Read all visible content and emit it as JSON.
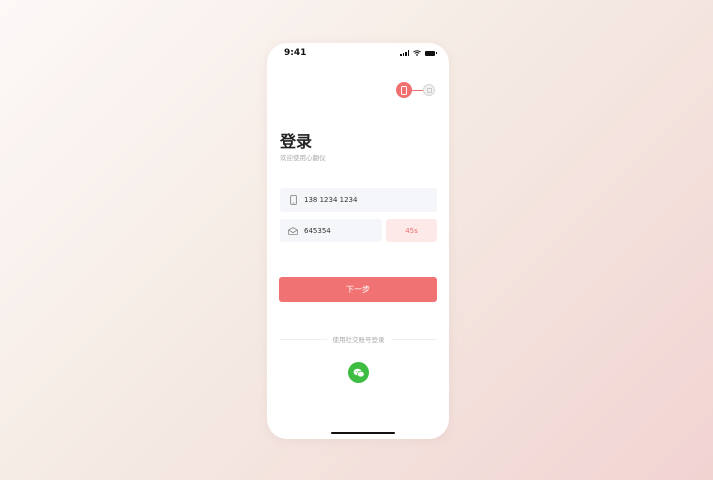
{
  "status_bar": {
    "time": "9:41"
  },
  "steps": {
    "active_icon": "phone-icon",
    "inactive_icon": "document-icon"
  },
  "login": {
    "title": "登录",
    "subtitle": "欢迎使用心翻仪"
  },
  "phone_field": {
    "value": "138 1234 1234",
    "icon": "phone-icon"
  },
  "code_field": {
    "value": "645354",
    "icon": "envelope-icon"
  },
  "countdown_button": {
    "label": "45s"
  },
  "next_button": {
    "label": "下一步"
  },
  "social_login": {
    "label": "使用社交账号登录",
    "icon": "wechat-icon"
  },
  "colors": {
    "accent": "#f07272",
    "accent_light": "#fde9e8",
    "wechat": "#3ebd42"
  }
}
